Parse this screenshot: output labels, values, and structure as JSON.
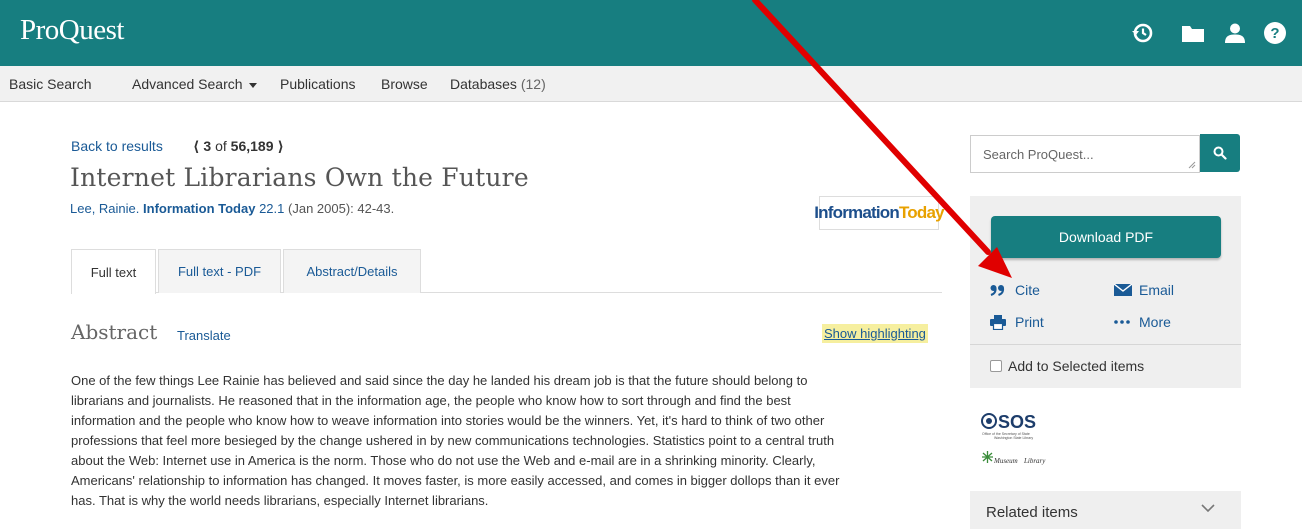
{
  "header": {
    "logo": "ProQuest",
    "icons": [
      "history-icon",
      "folder-icon",
      "user-icon",
      "help-icon"
    ]
  },
  "nav": {
    "basic_search": "Basic Search",
    "advanced_search": "Advanced Search",
    "publications": "Publications",
    "browse": "Browse",
    "databases": "Databases",
    "databases_count": "(12)"
  },
  "record": {
    "back_link": "Back to results",
    "pager_current": "3",
    "pager_of": "of",
    "pager_total": "56,189",
    "title": "Internet Librarians Own the Future",
    "author": "Lee, Rainie.",
    "publication": "Information Today",
    "volume": "22.1",
    "date_pages": "(Jan 2005): 42-43.",
    "pub_logo_part1": "Information",
    "pub_logo_part2": "Today"
  },
  "tabs": [
    {
      "label": "Full text",
      "active": true
    },
    {
      "label": "Full text - PDF",
      "active": false
    },
    {
      "label": "Abstract/Details",
      "active": false
    }
  ],
  "abstract": {
    "heading": "Abstract",
    "translate": "Translate",
    "show_highlighting": "Show highlighting",
    "lines": [
      "One of the few things Lee Rainie has believed and said since the day he landed his dream job is that the future should belong to",
      "librarians and journalists. He reasoned that in the information age, the people who know how to sort through and find the best",
      "information and the people who know how to weave information into stories would be the winners. Yet, it's hard to think of two other",
      "professions that feel more besieged by the change ushered in by new communications technologies. Statistics point to a central truth",
      "about the Web: Internet use in America is the norm. Those who do not use the Web and e-mail are in a shrinking minority. Clearly,",
      "Americans' relationship to information has changed. It moves faster, is more easily accessed, and comes in bigger dollops than it ever",
      "has. That is why the world needs librarians, especially Internet librarians."
    ]
  },
  "sidebar": {
    "search_placeholder": "Search ProQuest...",
    "download_pdf": "Download PDF",
    "cite": "Cite",
    "email": "Email",
    "print": "Print",
    "more": "More",
    "add_selected": "Add to Selected items",
    "related": "Related items",
    "sos_text": "SOS",
    "sos_caption": "Office of the Secretary of State",
    "sos_caption2": "Washington State Library",
    "museum_text": "Museum",
    "library_text": "Library"
  },
  "colors": {
    "brand_teal": "#177e80",
    "link_blue": "#1a5a96",
    "highlight_yellow": "#f6ef9f",
    "annotation_red": "#e00000"
  }
}
